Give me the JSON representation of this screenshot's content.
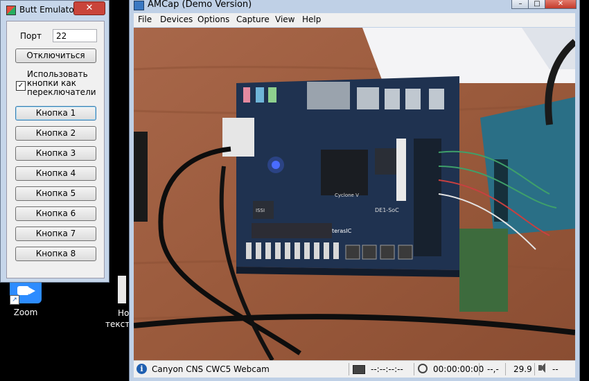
{
  "desktop": {
    "zoom_label": "Zoom",
    "zoom_shortcut_arrow": "↗",
    "note_label_1": "Но",
    "note_label_2": "текст"
  },
  "butt_emulator": {
    "title": "Butt Emulator",
    "close_glyph": "✕",
    "port_label": "Порт",
    "port_value": "22",
    "disconnect_label": "Отключиться",
    "use_as_switches_label": "Использовать кнопки как переключатели",
    "use_as_switches_checked": true,
    "check_glyph": "✓",
    "buttons": [
      "Кнопка 1",
      "Кнопка 2",
      "Кнопка 3",
      "Кнопка 4",
      "Кнопка 5",
      "Кнопка 6",
      "Кнопка 7",
      "Кнопка 8"
    ]
  },
  "amcap": {
    "title": "AMCap (Demo Version)",
    "ctrl_min_glyph": "–",
    "ctrl_max_glyph": "□",
    "ctrl_close_glyph": "✕",
    "menu": [
      "File",
      "Devices",
      "Options",
      "Capture",
      "View",
      "Help"
    ],
    "status": {
      "info_glyph": "i",
      "device": "Canyon CNS CWC5 Webcam",
      "frame_counter": "--:--:--:--",
      "elapsed_time": "00:00:00:00",
      "frames_dropped": "--,-",
      "fps": "29.9",
      "volume": "--"
    },
    "video_board_labels": {
      "fpga_brand": "Cyclone V",
      "board_name": "DE1-SoC",
      "vendor": "terasIC",
      "memory_chip": "ISSI"
    }
  },
  "colors": {
    "accent_blue": "#2d8cff",
    "close_red": "#c9443a",
    "window_frame": "#c6d6ea",
    "board_blue": "#1f3250",
    "table_wood": "#9a5a3c"
  }
}
